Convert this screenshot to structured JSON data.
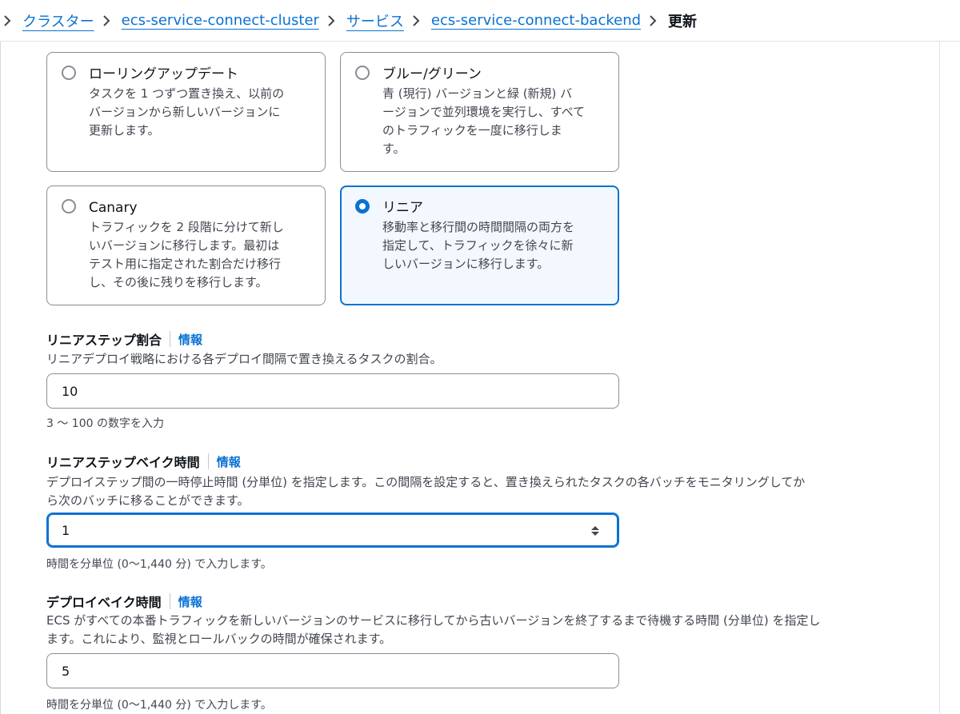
{
  "breadcrumb": {
    "items": [
      "クラスター",
      "ecs-service-connect-cluster",
      "サービス",
      "ecs-service-connect-backend"
    ],
    "current": "更新"
  },
  "deployment_options": [
    {
      "title": "ローリングアップデート",
      "desc_lines": [
        "タスクを 1 つずつ置き換え、以前の",
        "バージョンから新しいバージョンに",
        "更新します。"
      ],
      "selected": false
    },
    {
      "title": "ブルー/グリーン",
      "desc_lines": [
        "青 (現行) バージョンと緑 (新規) バ",
        "ージョンで並列環境を実行し、すべて",
        "のトラフィックを一度に移行しま",
        "す。"
      ],
      "selected": false
    },
    {
      "title": "Canary",
      "desc_lines": [
        "トラフィックを 2 段階に分けて新し",
        "いバージョンに移行します。最初は",
        "テスト用に指定された割合だけ移行",
        "し、その後に残りを移行します。"
      ],
      "selected": false
    },
    {
      "title": "リニア",
      "desc_lines": [
        "移動率と移行間の時間間隔の両方を",
        "指定して、トラフィックを徐々に新",
        "しいバージョンに移行します。"
      ],
      "selected": true
    }
  ],
  "linear_step": {
    "label": "リニアステップ割合",
    "info": "情報",
    "description": "リニアデプロイ戦略における各デプロイ間隔で置き換えるタスクの割合。",
    "value": "10",
    "hint": "3 ～ 100 の数字を入力"
  },
  "linear_bake": {
    "label": "リニアステップベイク時間",
    "info": "情報",
    "description_lines": [
      "デプロイステップ間の一時停止時間 (分単位) を指定します。この間隔を設定すると、置き換えられたタスクの各バッチをモニタリングしてか",
      "ら次のバッチに移ることができます。"
    ],
    "value": "1",
    "hint": "時間を分単位 (0〜1,440 分) で入力します。"
  },
  "deploy_bake": {
    "label": "デプロイベイク時間",
    "info": "情報",
    "description_lines": [
      "ECS がすべての本番トラフィックを新しいバージョンのサービスに移行してから古いバージョンを終了するまで待機する時間 (分単位) を指定し",
      "ます。これにより、監視とロールバックの時間が確保されます。"
    ],
    "value": "5",
    "hint": "時間を分単位 (0〜1,440 分) で入力します。"
  },
  "colors": {
    "accent": "#0972d3",
    "text": "#0f141a",
    "muted": "#424650",
    "selected_bg": "#f2f8fd"
  }
}
